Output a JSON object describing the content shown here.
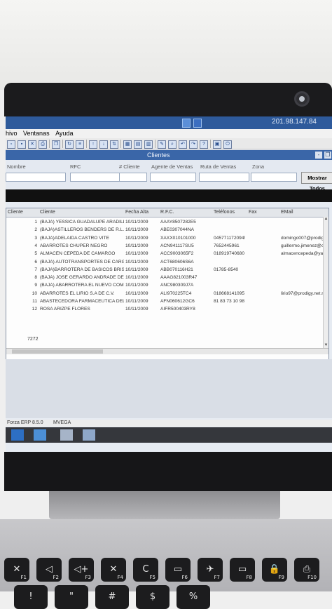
{
  "window": {
    "title_right": "201.98.147.84"
  },
  "menu": {
    "items": [
      "hivo",
      "Ventanas",
      "Ayuda"
    ]
  },
  "panel": {
    "title": "Clientes",
    "close_glyph": "-",
    "restore_glyph": "❐"
  },
  "filters": {
    "nombre_label": "Nombre",
    "rfc_label": "RFC",
    "num_cliente_label": "# Cliente",
    "agente_label": "Agente de Ventas",
    "ruta_label": "Ruta de Ventas",
    "zona_label": "Zona",
    "mostrar_button": "Mostrar Todos"
  },
  "table": {
    "columns": [
      "Cliente",
      "Cliente",
      "Fecha Alta",
      "R.F.C.",
      "Teléfonos",
      "Fax",
      "EMail"
    ],
    "rows": [
      {
        "num": "1",
        "name": "(BAJA) YESSICA GUADALUPE ARADILL",
        "fecha": "10/11/2009",
        "rfc": "AAAY8507282E5",
        "tel": "",
        "fax": "",
        "email": ""
      },
      {
        "num": "2",
        "name": "(BAJA)ASTILLEROS BENDERS DE R.L.",
        "fecha": "10/11/2009",
        "rfc": "ABE0307044NA",
        "tel": "",
        "fax": "",
        "email": ""
      },
      {
        "num": "3",
        "name": "(BAJA)ADELAIDA CASTRO VITE",
        "fecha": "10/11/2009",
        "rfc": "XAXX010101000",
        "tel": "045771172094!",
        "fax": "",
        "email": "domingo007@prodigy"
      },
      {
        "num": "4",
        "name": "ABARROTES CHUPER NEGRO",
        "fecha": "10/11/2009",
        "rfc": "ACN941117SU5",
        "tel": "7652445961",
        "fax": "",
        "email": "guillermo.jimenez@ch"
      },
      {
        "num": "5",
        "name": "ALMACEN CEPEDA DE CAMARGO",
        "fecha": "10/11/2009",
        "rfc": "ACC9003065F2",
        "tel": "018919740680",
        "fax": "",
        "email": "almacencepeda@yah"
      },
      {
        "num": "6",
        "name": "(BAJA) AUTOTRANSPORTES DE CARG/",
        "fecha": "10/11/2009",
        "rfc": "ACT680606S6A",
        "tel": "",
        "fax": "",
        "email": ""
      },
      {
        "num": "7",
        "name": "(BAJA)BARROTERA DE BASICOS BRISI",
        "fecha": "10/11/2009",
        "rfc": "ABB070116H21",
        "tel": "01785-8540",
        "fax": "",
        "email": ""
      },
      {
        "num": "8",
        "name": "(BAJA) JOSE GERARDO ANDRADE DEL",
        "fecha": "10/11/2009",
        "rfc": "AAAG821003R47",
        "tel": "",
        "fax": "",
        "email": ""
      },
      {
        "num": "9",
        "name": "(BAJA) ABARROTERA EL NUEVO COME",
        "fecha": "10/11/2009",
        "rfc": "ANC980309J7A",
        "tel": "",
        "fax": "",
        "email": ""
      },
      {
        "num": "10",
        "name": "ABARROTES EL LIRIO S.A DE C.V.",
        "fecha": "10/11/2009",
        "rfc": "ALI970225TC4",
        "tel": "018668141095",
        "fax": "",
        "email": "lirio97@prodigy.net.m"
      },
      {
        "num": "11",
        "name": "ABASTECEDORA FARMACEUTICA DEL I",
        "fecha": "10/11/2009",
        "rfc": "AFN060612GC6",
        "tel": "81 83 73 10 98",
        "fax": "",
        "email": ""
      },
      {
        "num": "12",
        "name": "ROSA ARIZPE FLORES",
        "fecha": "10/11/2009",
        "rfc": "AIFR500403RY8",
        "tel": "",
        "fax": "",
        "email": ""
      }
    ],
    "record_count": "7272"
  },
  "status": {
    "left": "Forza ERP  8.5.0",
    "right": "MVEGA"
  },
  "keyboard": {
    "keys": [
      {
        "glyph": "✕",
        "fn": "F1"
      },
      {
        "glyph": "◁",
        "fn": "F2"
      },
      {
        "glyph": "◁+",
        "fn": "F3"
      },
      {
        "glyph": "✕",
        "fn": "F4"
      },
      {
        "glyph": "C",
        "fn": "F5"
      },
      {
        "glyph": "▭",
        "fn": "F6"
      },
      {
        "glyph": "✈",
        "fn": "F7"
      },
      {
        "glyph": "▭",
        "fn": "F8"
      },
      {
        "glyph": "🔒",
        "fn": "F9"
      },
      {
        "glyph": "⎙",
        "fn": "F10"
      }
    ],
    "number_row": [
      "!",
      "\"",
      "#",
      "$",
      "%"
    ]
  },
  "colors": {
    "accent": "#2e5a9b",
    "panel_header": "#3a66a8"
  }
}
